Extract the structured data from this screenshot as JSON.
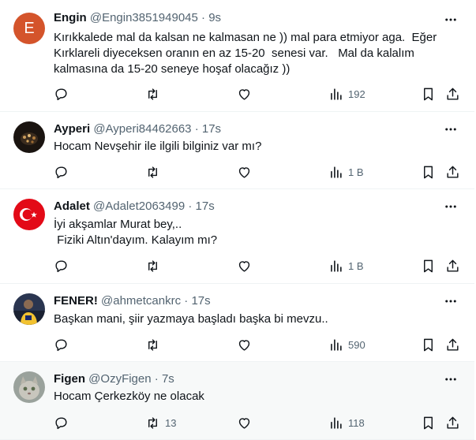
{
  "tweets": [
    {
      "avatar_letter": "E",
      "name": "Engin",
      "handle": "@Engin3851949045",
      "sep": "·",
      "time": "9s",
      "text": "Kırıkkalede mal da kalsan ne kalmasan ne )) mal para etmiyor aga.  Eğer\nKırklareli diyeceksen oranın en az 15-20  senesi var.   Mal da kalalım\nkalmasına da 15-20 seneye hoşaf olacağız ))",
      "retweets": "",
      "views": "192"
    },
    {
      "name": "Ayperi",
      "handle": "@Ayperi84462663",
      "sep": "·",
      "time": "17s",
      "text": "Hocam Nevşehir ile ilgili bilginiz var mı?",
      "retweets": "",
      "views": "1 B"
    },
    {
      "name": "Adalet",
      "handle": "@Adalet2063499",
      "sep": "·",
      "time": "17s",
      "text": "İyi akşamlar Murat bey,..\n Fiziki Altın'dayım. Kalayım mı?",
      "retweets": "",
      "views": "1 B"
    },
    {
      "name": "FENER!",
      "handle": "@ahmetcankrc",
      "sep": "·",
      "time": "17s",
      "text": "Başkan mani, şiir yazmaya başladı başka bi mevzu..",
      "retweets": "",
      "views": "590"
    },
    {
      "name": "Figen",
      "handle": "@OzyFigen",
      "sep": "·",
      "time": "7s",
      "text": "Hocam Çerkezköy ne olacak",
      "retweets": "13",
      "views": "118"
    }
  ],
  "colors": {
    "text": "#0f1419",
    "muted": "#536471",
    "border": "#eff3f4",
    "highlight_bg": "#f7f9f9",
    "avatar_e": "#d4542b"
  },
  "icons": [
    "more-icon",
    "reply-icon",
    "retweet-icon",
    "like-icon",
    "views-icon",
    "bookmark-icon",
    "share-icon"
  ]
}
